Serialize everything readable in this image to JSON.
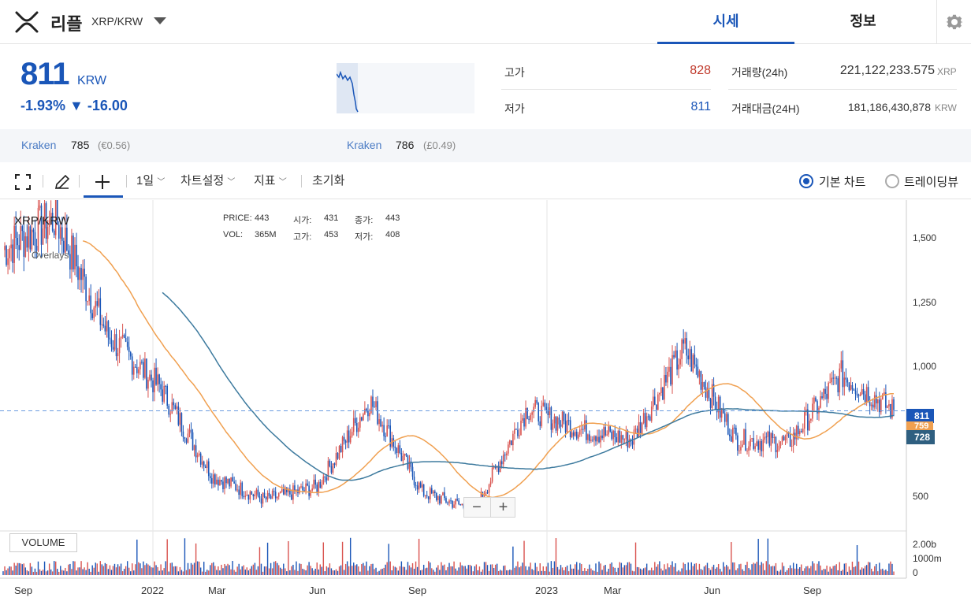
{
  "header": {
    "coin_name": "리플",
    "pair": "XRP/KRW",
    "tabs": [
      {
        "label": "시세",
        "active": true
      },
      {
        "label": "정보",
        "active": false
      }
    ]
  },
  "price": {
    "current": "811",
    "unit": "KRW",
    "change": "-1.93% ▼ -16.00",
    "color": "#1a56b8"
  },
  "stats": {
    "high_label": "고가",
    "high_value": "828",
    "low_label": "저가",
    "low_value": "811",
    "volume_label": "거래량(24h)",
    "volume_value": "221,122,233.575",
    "volume_unit": "XRP",
    "amount_label": "거래대금(24H)",
    "amount_value": "181,186,430,878",
    "amount_unit": "KRW"
  },
  "exchanges": [
    {
      "name": "Kraken",
      "value": "785",
      "sub": "(€0.56)"
    },
    {
      "name": "Kraken",
      "value": "786",
      "sub": "(£0.49)"
    }
  ],
  "toolbar": {
    "interval": "1일",
    "chart_settings": "차트설정",
    "indicators": "지표",
    "reset": "초기화",
    "basic_chart": "기본 차트",
    "tradingview": "트레이딩뷰"
  },
  "chart": {
    "title": "XRP/KRW",
    "overlays_label": "Overlays",
    "ohlc": {
      "price_label": "PRICE:",
      "price": "443",
      "open_label": "시가:",
      "open": "431",
      "close_label": "종가:",
      "close": "443",
      "vol_label": "VOL:",
      "vol": "365M",
      "high_label": "고가:",
      "high": "453",
      "low_label": "저가:",
      "low": "408"
    },
    "volume_label": "VOLUME",
    "y_ticks": [
      "1,500",
      "1,250",
      "1,000",
      "500"
    ],
    "vol_ticks": [
      "2.00b",
      "1000m",
      "0"
    ],
    "x_ticks": [
      "Sep",
      "2022",
      "Mar",
      "Jun",
      "Sep",
      "2023",
      "Mar",
      "Jun",
      "Sep"
    ],
    "badges": {
      "last": "811",
      "ma1": "759",
      "ma2": "728"
    },
    "colors": {
      "up": "#d9534f",
      "down": "#1a56b8",
      "ma_short": "#f0a050",
      "ma_long": "#3d7a9e"
    }
  },
  "chart_data": {
    "type": "line",
    "title": "XRP/KRW",
    "x": [
      "2021-09",
      "2021-11",
      "2022-01",
      "2022-03",
      "2022-05",
      "2022-06",
      "2022-08",
      "2022-09",
      "2022-11",
      "2023-01",
      "2023-03",
      "2023-05",
      "2023-06",
      "2023-07",
      "2023-08",
      "2023-09",
      "2023-11",
      "2023-12"
    ],
    "series": [
      {
        "values": [
          1430,
          1550,
          1100,
          900,
          560,
          470,
          520,
          850,
          500,
          430,
          820,
          740,
          700,
          1050,
          700,
          690,
          950,
          811
        ]
      }
    ],
    "ylim": [
      350,
      1620
    ]
  }
}
